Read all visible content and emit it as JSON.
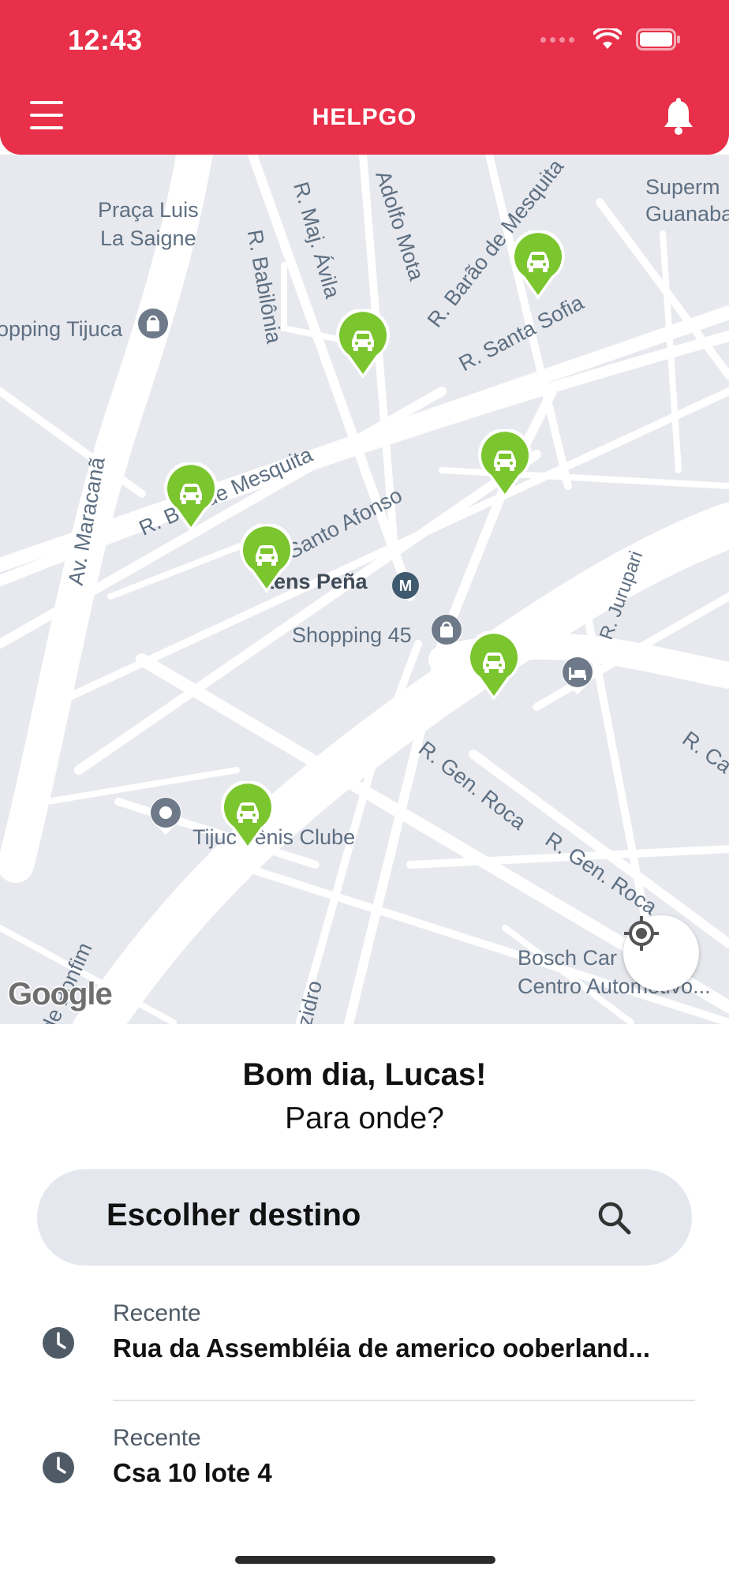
{
  "status_bar": {
    "time": "12:43"
  },
  "header": {
    "title": "HELPGO",
    "menu_icon": "menu-icon",
    "notification_icon": "bell-icon",
    "color": "#e8304a"
  },
  "map": {
    "labels": {
      "praca": "Praça Luis\nLa Saigne",
      "supermercado": "Superm\nGuanabara",
      "rua_maj_avila": "R. Maj. Ávila",
      "rua_babilonia": "R. Babilônia",
      "rua_adolfo_mota": "Adolfo Mota",
      "rua_barao_mesquita_top": "R. Barão de Mesquita",
      "rua_santa_sofia": "R. Santa Sofia",
      "shopping_tijuca": "opping Tijuca",
      "av_maracana": "Av. Maracanã",
      "rua_barao_mesquita": "R. B     de Mesquita",
      "rua_santo_afonso": "Santo Afonso",
      "saens_pena": "aens Peña",
      "rua_jurupari": "R. Jurupari",
      "shopping_45": "Shopping 45",
      "rua_gen_roca_1": "R. Gen. Roca",
      "rua_gen_roca_2": "R. Gen. Roca",
      "rua_ca": "R. Ca",
      "tijuca_tenis": "Tijuc   ênis Clube",
      "bosch": "Bosch Car      ce -\nCentro Automotivo...",
      "rua_bonfim": "de Bonfim",
      "rua_izidro": "Izidro",
      "google": "Google"
    },
    "car_pin_color": "#7bc52e",
    "locate_icon": "crosshair-icon"
  },
  "greeting": "Bom dia, Lucas!",
  "question": "Para onde?",
  "search": {
    "label": "Escolher destino",
    "icon": "search-icon"
  },
  "recents": [
    {
      "kind": "Recente",
      "address": "Rua da Assembléia de americo ooberland...",
      "icon": "clock-icon"
    },
    {
      "kind": "Recente",
      "address": "Csa 10 lote 4",
      "icon": "clock-icon"
    }
  ]
}
